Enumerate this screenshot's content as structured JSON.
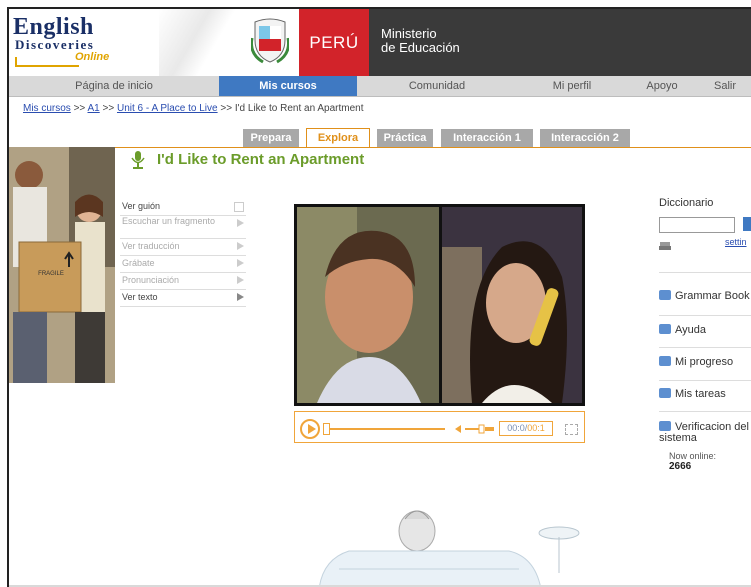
{
  "header": {
    "logo": {
      "line1": "English",
      "line2": "Discoveries",
      "line3": "Online"
    },
    "country": "PERÚ",
    "ministry_line1": "Ministerio",
    "ministry_line2": "de Educación"
  },
  "nav": {
    "items": [
      {
        "label": "Página de inicio"
      },
      {
        "label": "Mis cursos",
        "active": true
      },
      {
        "label": "Comunidad"
      },
      {
        "label": "Mi perfil"
      },
      {
        "label": "Apoyo"
      },
      {
        "label": "Salir"
      }
    ]
  },
  "breadcrumb": {
    "items": [
      "Mis cursos",
      "A1",
      "Unit 6 - A Place to Live"
    ],
    "separator": ">>",
    "current": "I'd Like to Rent an Apartment"
  },
  "tabs": [
    {
      "label": "Prepara"
    },
    {
      "label": "Explora",
      "active": true
    },
    {
      "label": "Práctica"
    },
    {
      "label": "Interacción 1"
    },
    {
      "label": "Interacción 2"
    }
  ],
  "lesson": {
    "title": "I'd Like to Rent an Apartment"
  },
  "menu": [
    {
      "label": "Ver guión",
      "icon": "checkbox"
    },
    {
      "label": "Escuchar un fragmento",
      "icon": "arrow"
    },
    {
      "label": "Ver traducción",
      "icon": "arrow"
    },
    {
      "label": "Grábate",
      "icon": "arrow"
    },
    {
      "label": "Pronunciación",
      "icon": "arrow"
    },
    {
      "label": "Ver texto",
      "icon": "arrow"
    }
  ],
  "player": {
    "current_time": "00:0",
    "separator": "/",
    "duration": "00:1"
  },
  "sidebar": {
    "dictionary_label": "Diccionario",
    "settings_link": "settin",
    "items": [
      {
        "label": "Grammar Book"
      },
      {
        "label": "Ayuda"
      },
      {
        "label": "Mi progreso"
      },
      {
        "label": "Mis tareas"
      },
      {
        "label": "Verificacion del sistema"
      }
    ],
    "online_label": "Now online:",
    "online_count": "2666"
  },
  "colors": {
    "accent_orange": "#e0901a",
    "title_green": "#6b9c2a",
    "nav_blue": "#3f79c2",
    "peru_red": "#d2232a"
  }
}
